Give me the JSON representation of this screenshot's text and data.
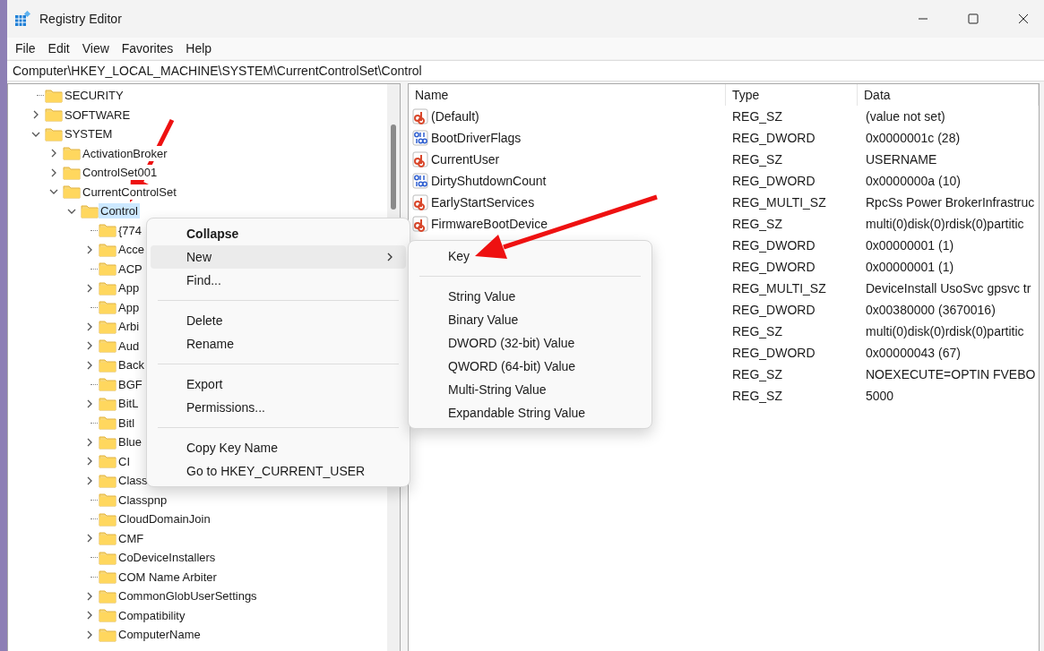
{
  "window": {
    "title": "Registry Editor"
  },
  "menu_bar": [
    "File",
    "Edit",
    "View",
    "Favorites",
    "Help"
  ],
  "address": "Computer\\HKEY_LOCAL_MACHINE\\SYSTEM\\CurrentControlSet\\Control",
  "tree": [
    {
      "label": "SECURITY",
      "has_children": false,
      "selected": false
    },
    {
      "label": "SOFTWARE",
      "has_children": true,
      "expanded": false,
      "selected": false
    },
    {
      "label": "SYSTEM",
      "has_children": true,
      "expanded": true,
      "selected": false,
      "children": [
        {
          "label": "ActivationBroker",
          "has_children": true,
          "expanded": false,
          "selected": false
        },
        {
          "label": "ControlSet001",
          "has_children": true,
          "expanded": false,
          "selected": false
        },
        {
          "label": "CurrentControlSet",
          "has_children": true,
          "expanded": true,
          "selected": false,
          "children": [
            {
              "label": "Control",
              "has_children": true,
              "expanded": true,
              "selected": true,
              "children": [
                {
                  "label": "{774",
                  "has_children": false,
                  "selected": false
                },
                {
                  "label": "Acce",
                  "has_children": true,
                  "expanded": false,
                  "selected": false
                },
                {
                  "label": "ACP",
                  "has_children": false,
                  "selected": false
                },
                {
                  "label": "App",
                  "has_children": true,
                  "expanded": false,
                  "selected": false
                },
                {
                  "label": "App",
                  "has_children": false,
                  "selected": false
                },
                {
                  "label": "Arbi",
                  "has_children": true,
                  "expanded": false,
                  "selected": false
                },
                {
                  "label": "Aud",
                  "has_children": true,
                  "expanded": false,
                  "selected": false
                },
                {
                  "label": "Back",
                  "has_children": true,
                  "expanded": false,
                  "selected": false
                },
                {
                  "label": "BGF",
                  "has_children": false,
                  "selected": false
                },
                {
                  "label": "BitL",
                  "has_children": true,
                  "expanded": false,
                  "selected": false
                },
                {
                  "label": "Bitl",
                  "has_children": false,
                  "selected": false
                },
                {
                  "label": "Blue",
                  "has_children": true,
                  "expanded": false,
                  "selected": false
                },
                {
                  "label": "CI",
                  "has_children": true,
                  "expanded": false,
                  "selected": false
                },
                {
                  "label": "Class",
                  "has_children": true,
                  "expanded": false,
                  "selected": false
                },
                {
                  "label": "Classpnp",
                  "has_children": false,
                  "selected": false
                },
                {
                  "label": "CloudDomainJoin",
                  "has_children": false,
                  "selected": false
                },
                {
                  "label": "CMF",
                  "has_children": true,
                  "expanded": false,
                  "selected": false
                },
                {
                  "label": "CoDeviceInstallers",
                  "has_children": false,
                  "selected": false
                },
                {
                  "label": "COM Name Arbiter",
                  "has_children": false,
                  "selected": false
                },
                {
                  "label": "CommonGlobUserSettings",
                  "has_children": true,
                  "expanded": false,
                  "selected": false
                },
                {
                  "label": "Compatibility",
                  "has_children": true,
                  "expanded": false,
                  "selected": false
                },
                {
                  "label": "ComputerName",
                  "has_children": true,
                  "expanded": false,
                  "selected": false
                }
              ]
            }
          ]
        }
      ]
    }
  ],
  "table": {
    "columns": [
      "Name",
      "Type",
      "Data"
    ],
    "rows": [
      {
        "kind": "string",
        "name": "(Default)",
        "type": "REG_SZ",
        "data": "(value not set)"
      },
      {
        "kind": "binary",
        "name": "BootDriverFlags",
        "type": "REG_DWORD",
        "data": "0x0000001c (28)"
      },
      {
        "kind": "string",
        "name": "CurrentUser",
        "type": "REG_SZ",
        "data": "USERNAME"
      },
      {
        "kind": "binary",
        "name": "DirtyShutdownCount",
        "type": "REG_DWORD",
        "data": "0x0000000a (10)"
      },
      {
        "kind": "string",
        "name": "EarlyStartServices",
        "type": "REG_MULTI_SZ",
        "data": "RpcSs Power BrokerInfrastruc"
      },
      {
        "kind": "string",
        "name": "FirmwareBootDevice",
        "type": "REG_SZ",
        "data": "multi(0)disk(0)rdisk(0)partitic"
      },
      {
        "type": "REG_DWORD",
        "data": "0x00000001 (1)"
      },
      {
        "type": "REG_DWORD",
        "data": "0x00000001 (1)"
      },
      {
        "type": "REG_MULTI_SZ",
        "data": "DeviceInstall UsoSvc gpsvc tr"
      },
      {
        "type": "REG_DWORD",
        "data": "0x00380000 (3670016)"
      },
      {
        "type": "REG_SZ",
        "data": "multi(0)disk(0)rdisk(0)partitic"
      },
      {
        "type": "REG_DWORD",
        "data": "0x00000043 (67)"
      },
      {
        "type": "REG_SZ",
        "data": " NOEXECUTE=OPTIN  FVEBO"
      },
      {
        "type": "REG_SZ",
        "data": "5000"
      }
    ]
  },
  "context_menu": [
    {
      "kind": "item",
      "label": "Collapse",
      "default": true,
      "has_submenu": false,
      "selected": false
    },
    {
      "kind": "item",
      "label": "New",
      "default": false,
      "has_submenu": true,
      "selected": true
    },
    {
      "kind": "item",
      "label": "Find...",
      "default": false,
      "has_submenu": false,
      "selected": false
    },
    {
      "kind": "separator"
    },
    {
      "kind": "item",
      "label": "Delete",
      "default": false,
      "has_submenu": false,
      "selected": false
    },
    {
      "kind": "item",
      "label": "Rename",
      "default": false,
      "has_submenu": false,
      "selected": false
    },
    {
      "kind": "separator"
    },
    {
      "kind": "item",
      "label": "Export",
      "default": false,
      "has_submenu": false,
      "selected": false
    },
    {
      "kind": "item",
      "label": "Permissions...",
      "default": false,
      "has_submenu": false,
      "selected": false
    },
    {
      "kind": "separator"
    },
    {
      "kind": "item",
      "label": "Copy Key Name",
      "default": false,
      "has_submenu": false,
      "selected": false
    },
    {
      "kind": "item",
      "label": "Go to HKEY_CURRENT_USER",
      "default": false,
      "has_submenu": false,
      "selected": false
    }
  ],
  "submenu": [
    {
      "kind": "item",
      "label": "Key"
    },
    {
      "kind": "separator"
    },
    {
      "kind": "item",
      "label": "String Value"
    },
    {
      "kind": "item",
      "label": "Binary Value"
    },
    {
      "kind": "item",
      "label": "DWORD (32-bit) Value"
    },
    {
      "kind": "item",
      "label": "QWORD (64-bit) Value"
    },
    {
      "kind": "item",
      "label": "Multi-String Value"
    },
    {
      "kind": "item",
      "label": "Expandable String Value"
    }
  ]
}
